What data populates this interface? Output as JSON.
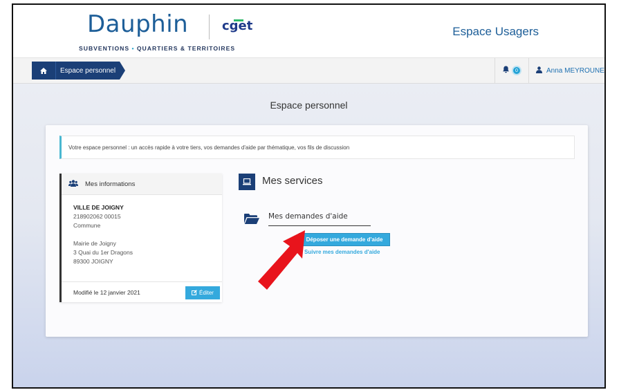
{
  "brand": {
    "logo_text": "Dauphin",
    "partner": "cget",
    "tagline_left": "SUBVENTIONS",
    "tagline_dot": "•",
    "tagline_right": "QUARTIERS & TERRITOIRES"
  },
  "header": {
    "portal_title": "Espace Usagers"
  },
  "breadcrumb": {
    "home_icon": "home-icon",
    "current": "Espace personnel"
  },
  "notifications": {
    "count": "0"
  },
  "user": {
    "name": "Anna MEYROUNE"
  },
  "page": {
    "title": "Espace personnel"
  },
  "intro": "Votre espace personnel : un accès rapide à votre tiers, vos demandes d'aide par thématique, vos fils de discussion",
  "info_panel": {
    "title": "Mes informations",
    "name": "VILLE DE JOIGNY",
    "siret": "218902062 00015",
    "type": "Commune",
    "address_1": "Mairie de Joigny",
    "address_2": "3 Quai du 1er Dragons",
    "address_3": "89300 JOIGNY",
    "modified": "Modifié le 12 janvier 2021",
    "edit_label": "Éditer"
  },
  "services": {
    "title": "Mes services",
    "aid_title": "Mes demandes d'aide",
    "deposit_label": "Déposer une demande d'aide",
    "follow_label": "Suivre mes demandes d'aide"
  },
  "colors": {
    "navy": "#1b3f77",
    "accent": "#34a9dd",
    "annotation_arrow": "#e8141c"
  }
}
